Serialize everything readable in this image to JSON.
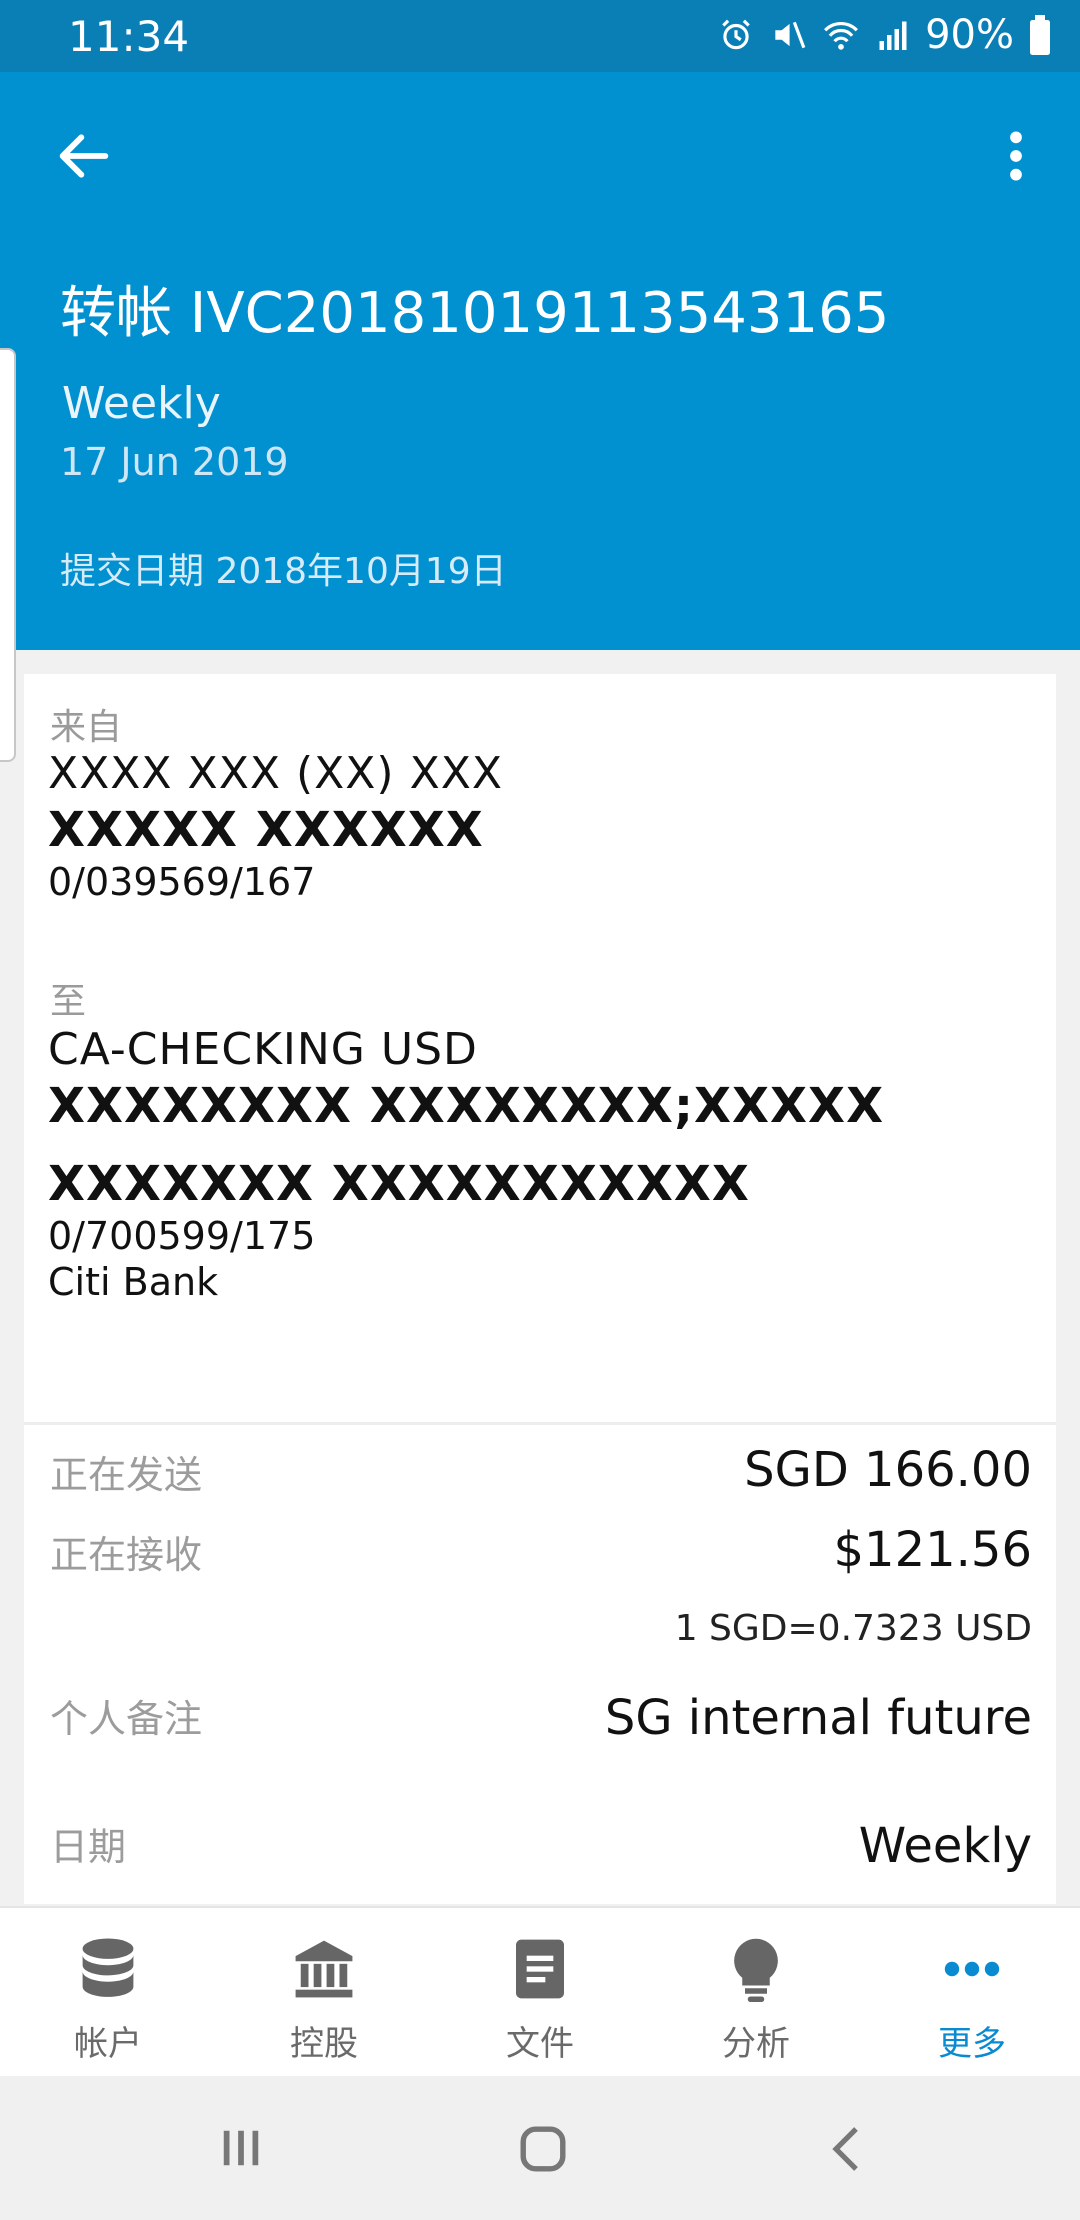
{
  "status_bar": {
    "time": "11:34",
    "battery": "90%"
  },
  "header": {
    "title": "转帐 IVC20181019113543165",
    "frequency": "Weekly",
    "date": "17 Jun 2019",
    "submitted": "提交日期 2018年10月19日"
  },
  "from": {
    "label": "来自",
    "line1": "XXXX XXX (XX) XXX",
    "line2": "XXXXX XXXXXX",
    "account": "0/039569/167"
  },
  "to": {
    "label": "至",
    "line1": "CA-CHECKING USD",
    "line2": "XXXXXXXX XXXXXXXX;XXXXX",
    "line3": "XXXXXXX XXXXXXXXXXX",
    "account": "0/700599/175",
    "bank": "Citi Bank"
  },
  "details": {
    "sending_label": "正在发送",
    "sending_value": "SGD 166.00",
    "receiving_label": "正在接收",
    "receiving_value": "$121.56",
    "rate": "1 SGD=0.7323 USD",
    "memo_label": "个人备注",
    "memo_value": "SG internal future",
    "date_label": "日期",
    "date_value": "Weekly"
  },
  "bottom_nav": [
    {
      "label": "帐户",
      "icon": "database-icon"
    },
    {
      "label": "控股",
      "icon": "bank-icon"
    },
    {
      "label": "文件",
      "icon": "document-icon"
    },
    {
      "label": "分析",
      "icon": "lightbulb-icon"
    },
    {
      "label": "更多",
      "icon": "more-horizontal-icon"
    }
  ],
  "colors": {
    "header": "#0190d0",
    "status_bar": "#0a7fb6",
    "active_nav": "#0a8ad0"
  }
}
